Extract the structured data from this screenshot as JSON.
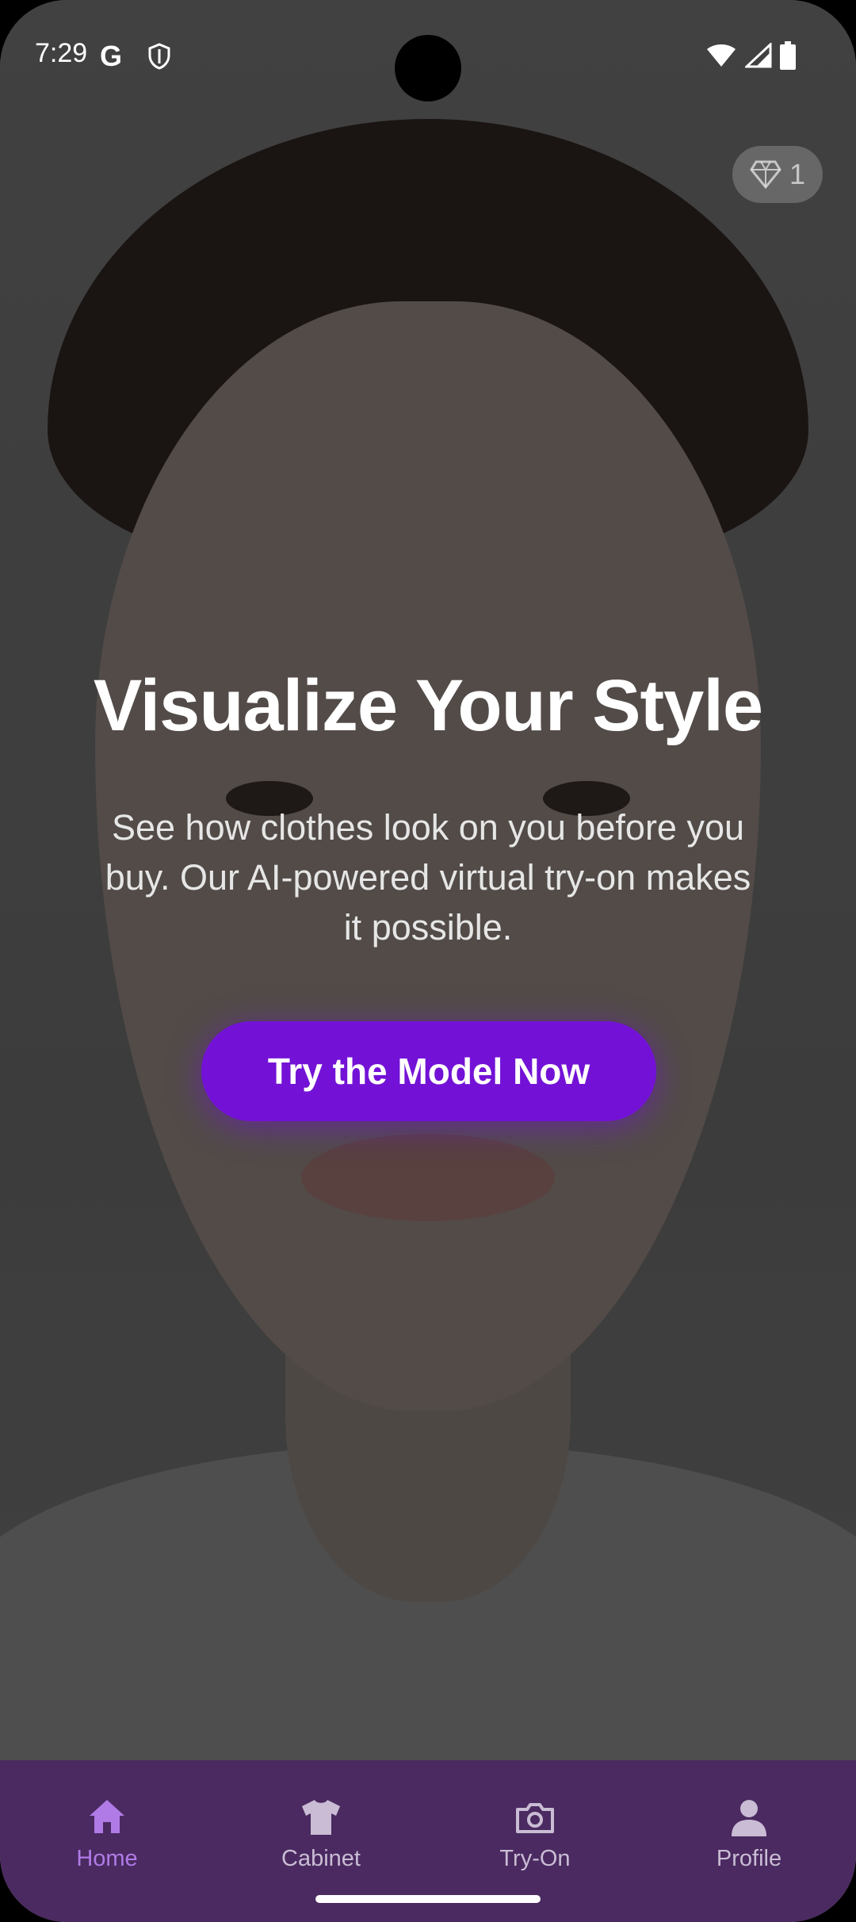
{
  "status_bar": {
    "time": "7:29",
    "g_label": "G"
  },
  "credits": {
    "count": "1",
    "icon": "diamond-icon"
  },
  "hero": {
    "title": "Visualize Your Style",
    "subtitle": "See how clothes look on you before you buy. Our AI-powered virtual try-on makes it possible.",
    "cta_label": "Try the Model Now"
  },
  "nav": {
    "items": [
      {
        "label": "Home",
        "icon": "home-icon",
        "active": true
      },
      {
        "label": "Cabinet",
        "icon": "shirt-icon",
        "active": false
      },
      {
        "label": "Try-On",
        "icon": "camera-icon",
        "active": false
      },
      {
        "label": "Profile",
        "icon": "person-icon",
        "active": false
      }
    ]
  },
  "colors": {
    "accent": "#7312d6",
    "nav_background": "#4a2a60",
    "nav_active": "#b07be6",
    "nav_inactive": "#c9bcd4"
  }
}
